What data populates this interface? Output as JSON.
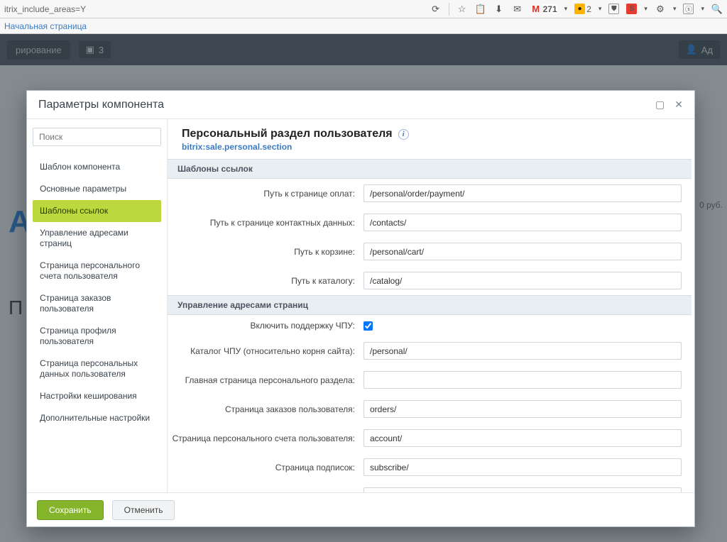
{
  "chrome": {
    "url_fragment": "itrix_include_areas=Y",
    "mail_count": "271",
    "notif_count": "2",
    "bookmark": "Начальная страница"
  },
  "backdrop": {
    "admin_btn": "рирование",
    "chip_count": "3",
    "user_prefix": "Ад",
    "ghost_letter": "А",
    "ghost_rub": "0 руб.",
    "ghost_p": "П"
  },
  "dialog": {
    "title": "Параметры компонента",
    "search_placeholder": "Поиск",
    "component_title": "Персональный раздел пользователя",
    "component_code": "bitrix:sale.personal.section",
    "save": "Сохранить",
    "cancel": "Отменить"
  },
  "nav": {
    "items": [
      "Шаблон компонента",
      "Основные параметры",
      "Шаблоны ссылок",
      "Управление адресами страниц",
      "Страница персонального счета пользователя",
      "Страница заказов пользователя",
      "Страница профиля пользователя",
      "Страница персональных данных пользователя",
      "Настройки кеширования",
      "Дополнительные настройки"
    ],
    "active_index": 2
  },
  "sections": {
    "s1_title": "Шаблоны ссылок",
    "s2_title": "Управление адресами страниц"
  },
  "fields": {
    "payment": {
      "label": "Путь к странице оплат:",
      "value": "/personal/order/payment/"
    },
    "contacts": {
      "label": "Путь к странице контактных данных:",
      "value": "/contacts/"
    },
    "cart": {
      "label": "Путь к корзине:",
      "value": "/personal/cart/"
    },
    "catalog": {
      "label": "Путь к каталогу:",
      "value": "/catalog/"
    },
    "sef": {
      "label": "Включить поддержку ЧПУ:"
    },
    "sef_folder": {
      "label": "Каталог ЧПУ (относительно корня сайта):",
      "value": "/personal/"
    },
    "main_page": {
      "label": "Главная страница персонального раздела:",
      "value": ""
    },
    "orders_page": {
      "label": "Страница заказов пользователя:",
      "value": "orders/"
    },
    "account_page": {
      "label": "Страница персонального счета пользователя:",
      "value": "account/"
    },
    "subscribe_page": {
      "label": "Страница подписок:",
      "value": "subscribe/"
    }
  }
}
